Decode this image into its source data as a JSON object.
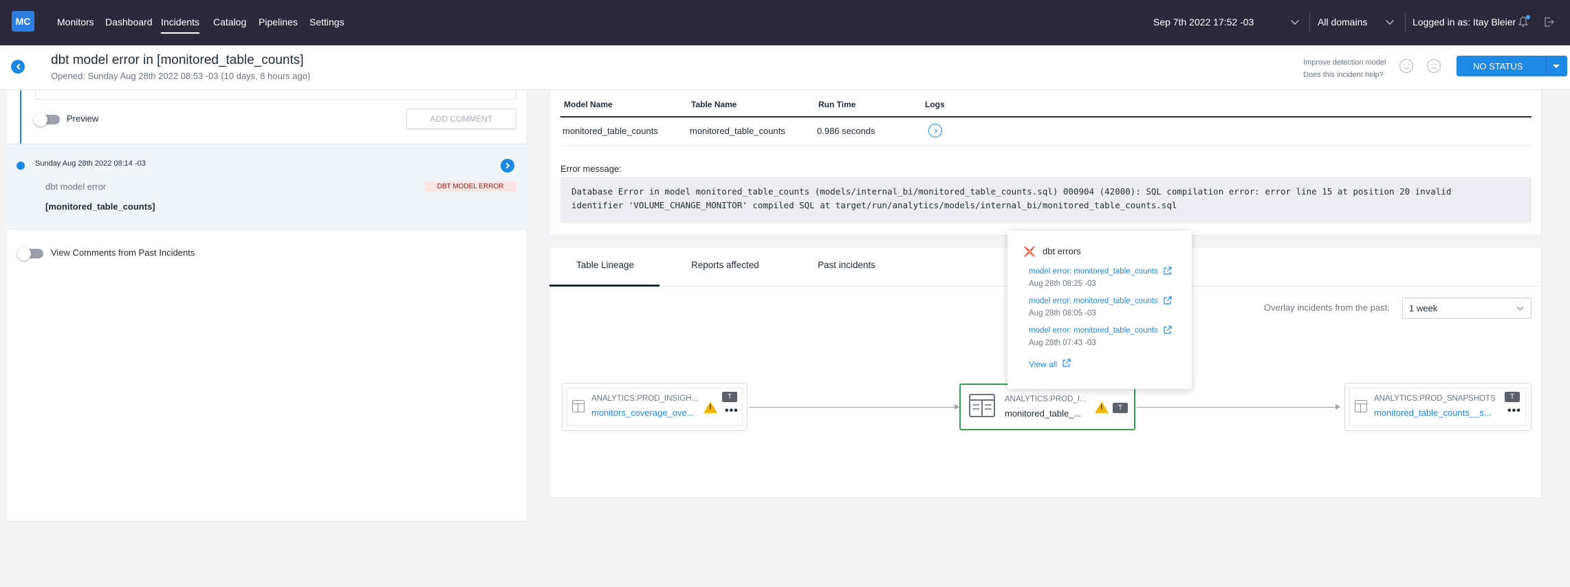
{
  "app": {
    "logo": "MC"
  },
  "nav": {
    "items": [
      {
        "label": "Monitors",
        "active": false
      },
      {
        "label": "Dashboard",
        "active": false
      },
      {
        "label": "Incidents",
        "active": true
      },
      {
        "label": "Catalog",
        "active": false
      },
      {
        "label": "Pipelines",
        "active": false
      },
      {
        "label": "Settings",
        "active": false
      }
    ],
    "datetime": "Sep 7th 2022 17:52 -03",
    "domain": "All domains",
    "user": "Logged in as: Itay Bleier"
  },
  "header": {
    "title": "dbt model error in [monitored_table_counts]",
    "subtitle": "Opened: Sunday Aug 28th 2022 08:53 -03 (10 days, 8 hours ago)",
    "improve_line1": "Improve detection model",
    "improve_line2": "Does this incident help?",
    "status_button": "NO STATUS"
  },
  "left": {
    "preview_label": "Preview",
    "add_comment": "ADD COMMENT",
    "event": {
      "date": "Sunday Aug 28th 2022 08:14 -03",
      "type": "dbt model error",
      "badge": "DBT MODEL ERROR",
      "table": "[monitored_table_counts]"
    },
    "past_comments_label": "View Comments from Past Incidents"
  },
  "error_details": {
    "columns": [
      "Model Name",
      "Table Name",
      "Run Time",
      "Logs"
    ],
    "row": {
      "model": "monitored_table_counts",
      "table": "monitored_table_counts",
      "run_time": "0.986 seconds"
    },
    "error_label": "Error message:",
    "error_line1": "Database Error in model monitored_table_counts (models/internal_bi/monitored_table_counts.sql) 000904 (42000): SQL compilation error: error line 15 at position 20 invalid",
    "error_line2": "identifier 'VOLUME_CHANGE_MONITOR' compiled SQL at target/run/analytics/models/internal_bi/monitored_table_counts.sql"
  },
  "lineage": {
    "tabs": [
      "Table Lineage",
      "Reports affected",
      "Past incidents"
    ],
    "overlay_label": "Overlay incidents from the past:",
    "overlay_value": "1 week",
    "nodes": [
      {
        "db": "ANALYTICS:PROD_INSIGH...",
        "name": "monitors_coverage_ove...",
        "badge": "T"
      },
      {
        "db": "ANALYTICS:PROD_I...",
        "name": "monitored_table_...",
        "badge": "T"
      },
      {
        "db": "ANALYTICS:PROD_SNAPSHOTS",
        "name": "monitored_table_counts__s...",
        "badge": "T"
      }
    ]
  },
  "popup": {
    "title": "dbt errors",
    "items": [
      {
        "link": "model error: monitored_table_counts",
        "date": "Aug 28th 08:25 -03"
      },
      {
        "link": "model error: monitored_table_counts",
        "date": "Aug 28th 08:05 -03"
      },
      {
        "link": "model error: monitored_table_counts",
        "date": "Aug 28th 07:43 -03"
      }
    ],
    "view_all": "View all"
  },
  "colors": {
    "nav_bg": "#2b2839",
    "accent": "#1e88e5",
    "error_badge_bg": "#fde4e4",
    "selected_node": "#2e9e4f",
    "warning": "#f2b705"
  }
}
